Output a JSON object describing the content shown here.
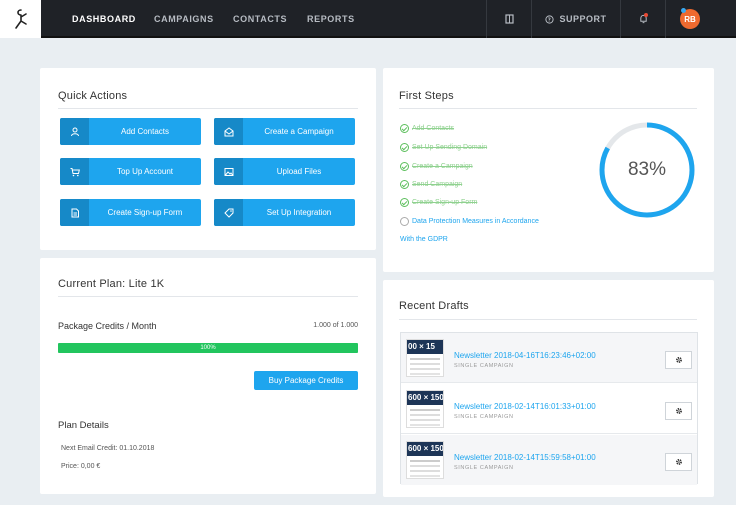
{
  "topbar": {
    "nav": [
      "DASHBOARD",
      "CAMPAIGNS",
      "CONTACTS",
      "REPORTS"
    ],
    "support_label": "SUPPORT",
    "avatar_initials": "RB"
  },
  "quick_actions": {
    "title": "Quick Actions",
    "buttons": [
      {
        "label": "Add Contacts",
        "icon": "contacts-icon"
      },
      {
        "label": "Create a Campaign",
        "icon": "campaign-icon"
      },
      {
        "label": "Top Up Account",
        "icon": "cart-icon"
      },
      {
        "label": "Upload Files",
        "icon": "image-icon"
      },
      {
        "label": "Create Sign-up Form",
        "icon": "form-icon"
      },
      {
        "label": "Set Up Integration",
        "icon": "tag-icon"
      }
    ]
  },
  "plan": {
    "title": "Current Plan: Lite 1K",
    "credits_label": "Package Credits / Month",
    "credits_value": "1.000 of 1.000",
    "progress_label": "100%",
    "progress_fraction": 1.0,
    "buy_label": "Buy Package Credits",
    "details_title": "Plan Details",
    "next_credit": "Next Email Credit: 01.10.2018",
    "price": "Price: 0,00 €"
  },
  "first_steps": {
    "title": "First Steps",
    "steps": [
      {
        "label": "Add Contacts",
        "done": true
      },
      {
        "label": "Set Up Sending Domain",
        "done": true
      },
      {
        "label": "Create a Campaign",
        "done": true
      },
      {
        "label": "Send Campaign",
        "done": true
      },
      {
        "label": "Create Sign-up Form",
        "done": true
      },
      {
        "label": "Data Protection Measures in Accordance",
        "done": false
      }
    ],
    "step_continuation": "With the GDPR",
    "percent_label": "83%",
    "percent_value": 83
  },
  "recent_drafts": {
    "title": "Recent Drafts",
    "items": [
      {
        "thumb": "00 × 15",
        "title": "Newsletter 2018-04-16T16:23:46+02:00",
        "subtitle": "SINGLE CAMPAIGN"
      },
      {
        "thumb": "600 × 150",
        "title": "Newsletter 2018-02-14T16:01:33+01:00",
        "subtitle": "SINGLE CAMPAIGN"
      },
      {
        "thumb": "600 × 150",
        "title": "Newsletter 2018-02-14T15:59:58+01:00",
        "subtitle": "SINGLE CAMPAIGN"
      }
    ]
  },
  "colors": {
    "accent": "#1ea5ee",
    "progress": "#22c55e",
    "topbar": "#1f2227",
    "avatar": "#ef6a2f"
  }
}
